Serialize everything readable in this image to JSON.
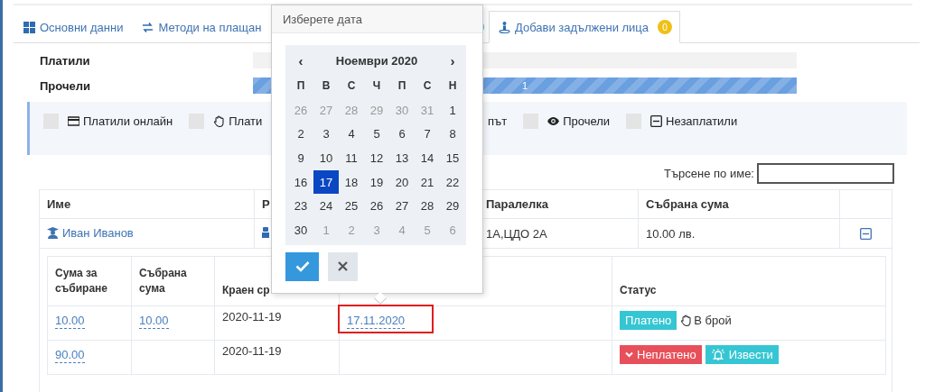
{
  "tabs": [
    {
      "label": "Основни данни",
      "selected": false
    },
    {
      "label": "Методи на плащан",
      "selected": false
    },
    {
      "label": "Добави задължени лица",
      "badge": "0",
      "selected": true
    }
  ],
  "progress": [
    {
      "label": "Платили",
      "level": 0
    },
    {
      "label": "Прочели",
      "level": 1,
      "reading": "1"
    }
  ],
  "filters": [
    {
      "kind": "full",
      "label": "Платили онлайн",
      "checked": false
    },
    {
      "kind": "full",
      "label": "Плати",
      "checked": false
    },
    {
      "kind": "tail",
      "label": "път"
    },
    {
      "kind": "full",
      "label": "Прочели",
      "checked": false
    },
    {
      "kind": "full",
      "label": "Незаплатили",
      "checked": false
    }
  ],
  "search": {
    "label": "Търсене по име:"
  },
  "table": {
    "columns": [
      "Име",
      "Р",
      "Паралелка",
      "Събрана сума"
    ],
    "rows": [
      {
        "name": "Иван Иванов",
        "class": "1А,ЦДО 2А",
        "collected": "10.00 лв.",
        "expanded": true
      }
    ]
  },
  "details": {
    "columns": [
      "Сума за събиране",
      "Събрана сума",
      "Краен ср",
      "Статус"
    ],
    "rows": [
      {
        "amount": "10.00",
        "collected": "10.00",
        "deadline": "2020-11-19",
        "paid_on": "17.11.2020",
        "highlighted": true,
        "kind": "paid",
        "status_label": "Платено",
        "method": "В брой"
      },
      {
        "amount": "90.00",
        "deadline": "2020-11-19",
        "kind": "unpaid",
        "status_label": "Неплатено",
        "action": "Извести"
      }
    ]
  },
  "datepicker": {
    "title": "Изберете дата",
    "prev": "‹",
    "month": "Ноември 2020",
    "next": "›",
    "weekdays": [
      "П",
      "В",
      "С",
      "Ч",
      "П",
      "С",
      "Н"
    ],
    "weeks": [
      [
        {
          "d": "26",
          "muted": true,
          "selected": false
        },
        {
          "d": "27",
          "muted": true,
          "selected": false
        },
        {
          "d": "28",
          "muted": true,
          "selected": false
        },
        {
          "d": "29",
          "muted": true,
          "selected": false
        },
        {
          "d": "30",
          "muted": true,
          "selected": false
        },
        {
          "d": "31",
          "muted": true,
          "selected": false
        },
        {
          "d": "1",
          "muted": false,
          "selected": false
        }
      ],
      [
        {
          "d": "2",
          "muted": false,
          "selected": false
        },
        {
          "d": "3",
          "muted": false,
          "selected": false
        },
        {
          "d": "4",
          "muted": false,
          "selected": false
        },
        {
          "d": "5",
          "muted": false,
          "selected": false
        },
        {
          "d": "6",
          "muted": false,
          "selected": false
        },
        {
          "d": "7",
          "muted": false,
          "selected": false
        },
        {
          "d": "8",
          "muted": false,
          "selected": false
        }
      ],
      [
        {
          "d": "9",
          "muted": false,
          "selected": false
        },
        {
          "d": "10",
          "muted": false,
          "selected": false
        },
        {
          "d": "11",
          "muted": false,
          "selected": false
        },
        {
          "d": "12",
          "muted": false,
          "selected": false
        },
        {
          "d": "13",
          "muted": false,
          "selected": false
        },
        {
          "d": "14",
          "muted": false,
          "selected": false
        },
        {
          "d": "15",
          "muted": false,
          "selected": false
        }
      ],
      [
        {
          "d": "16",
          "muted": false,
          "selected": false
        },
        {
          "d": "17",
          "muted": false,
          "selected": true
        },
        {
          "d": "18",
          "muted": false,
          "selected": false
        },
        {
          "d": "19",
          "muted": false,
          "selected": false
        },
        {
          "d": "20",
          "muted": false,
          "selected": false
        },
        {
          "d": "21",
          "muted": false,
          "selected": false
        },
        {
          "d": "22",
          "muted": false,
          "selected": false
        }
      ],
      [
        {
          "d": "23",
          "muted": false,
          "selected": false
        },
        {
          "d": "24",
          "muted": false,
          "selected": false
        },
        {
          "d": "25",
          "muted": false,
          "selected": false
        },
        {
          "d": "26",
          "muted": false,
          "selected": false
        },
        {
          "d": "27",
          "muted": false,
          "selected": false
        },
        {
          "d": "28",
          "muted": false,
          "selected": false
        },
        {
          "d": "29",
          "muted": false,
          "selected": false
        }
      ],
      [
        {
          "d": "30",
          "muted": false,
          "selected": false
        },
        {
          "d": "1",
          "muted": true,
          "selected": false
        },
        {
          "d": "2",
          "muted": true,
          "selected": false
        },
        {
          "d": "3",
          "muted": true,
          "selected": false
        },
        {
          "d": "4",
          "muted": true,
          "selected": false
        },
        {
          "d": "5",
          "muted": true,
          "selected": false
        },
        {
          "d": "6",
          "muted": true,
          "selected": false
        }
      ]
    ]
  }
}
